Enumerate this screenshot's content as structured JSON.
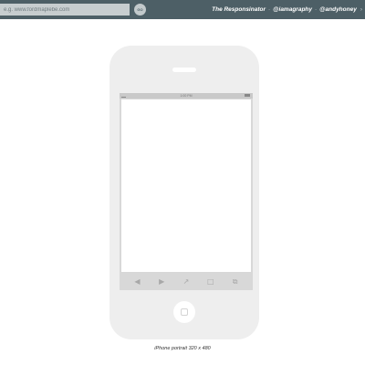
{
  "toolbar": {
    "url_placeholder": "e.g. www.fordmaplebe.com",
    "go_label": "GO",
    "app_title": "The Responsinator",
    "links": [
      "@iamagraphy",
      "@andyhoney"
    ],
    "separator": "·"
  },
  "device": {
    "status_time": "1:00 PM",
    "caption": "iPhone portrait 320 x 480"
  },
  "colors": {
    "topbar": "#4d5f66",
    "phone_body": "#eeeeee",
    "screen_frame": "#d8d8d8"
  },
  "icons": {
    "browser_toolbar": [
      "back-arrow-icon",
      "forward-arrow-icon",
      "share-icon",
      "bookmarks-icon",
      "tabs-icon"
    ],
    "home": "home-button-square-icon"
  }
}
